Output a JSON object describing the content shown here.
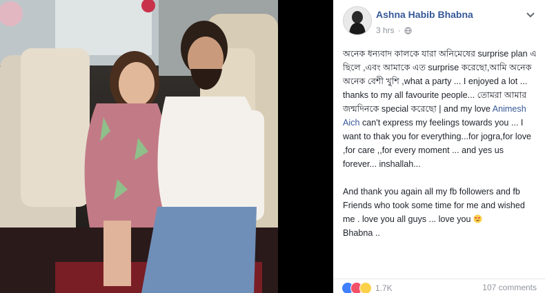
{
  "post": {
    "author": "Ashna Habib Bhabna",
    "time": "3 hrs",
    "visibility_icon": "globe-icon",
    "menu_icon": "chevron-down-icon",
    "paragraph1": {
      "text_before_mention": "অনেক ধন্যবাদ কালকে যারা অনিমেষের surprise plan এ ছিলে ,এবং আমাকে এত surprise করেছো,আমি অনেক অনেক বেশী খুশি ,what a party ... I enjoyed a lot ... thanks to my all favourite people... তোমরা আমার জন্মদিনকে special করেছো | and my love ",
      "mention": "Animesh Aich",
      "text_after_mention": " can't express my feelings towards you ... I want to thak you for everything...for jogra,for love ,for care ,,for every moment ... and yes us forever... inshallah..."
    },
    "paragraph2": {
      "text": "And thank you again all my fb followers and fb Friends who took some time for me and wished me . love you all guys ... love you",
      "emoji": "heart-eyes-emoji",
      "signature": "Bhabna .."
    },
    "footer": {
      "reaction_icons": [
        "like-reaction-icon",
        "love-reaction-icon",
        "wow-reaction-icon"
      ],
      "reaction_count": "1.7K",
      "comments": "107 comments"
    }
  },
  "colors": {
    "link": "#365899",
    "text": "#1d2129",
    "meta": "#90949c",
    "background": "#000000"
  }
}
